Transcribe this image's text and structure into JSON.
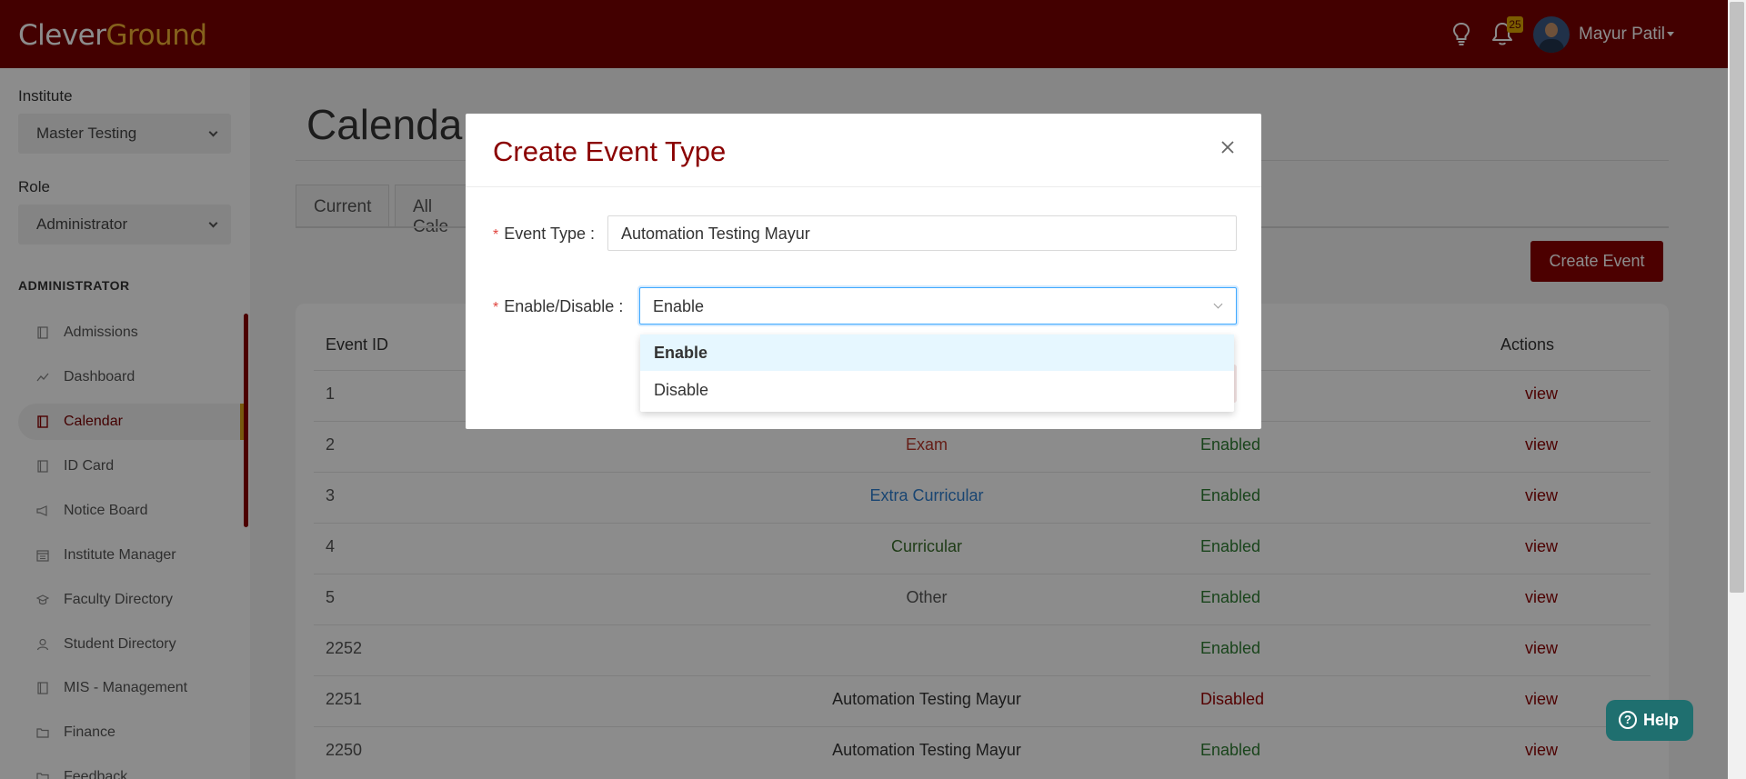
{
  "header": {
    "logo_part1": "Clever",
    "logo_part2": "Ground",
    "notification_count": "25",
    "user_name": "Mayur Patil",
    "colors": {
      "header_bg": "#7a0000",
      "logo_accent": "#f2b233"
    }
  },
  "sidebar": {
    "institute_label": "Institute",
    "institute_value": "Master Testing",
    "role_label": "Role",
    "role_value": "Administrator",
    "section_title": "ADMINISTRATOR",
    "items": [
      {
        "label": "Admissions",
        "icon": "book-icon"
      },
      {
        "label": "Dashboard",
        "icon": "chart-line-icon"
      },
      {
        "label": "Calendar",
        "icon": "book-icon",
        "active": true
      },
      {
        "label": "ID Card",
        "icon": "book-icon"
      },
      {
        "label": "Notice Board",
        "icon": "megaphone-icon"
      },
      {
        "label": "Institute Manager",
        "icon": "calendar-icon"
      },
      {
        "label": "Faculty Directory",
        "icon": "graduation-icon"
      },
      {
        "label": "Student Directory",
        "icon": "user-icon"
      },
      {
        "label": "MIS - Management",
        "icon": "book-icon"
      },
      {
        "label": "Finance",
        "icon": "folder-icon"
      },
      {
        "label": "Feedback",
        "icon": "folder-icon"
      }
    ]
  },
  "main": {
    "title": "Calenda",
    "tabs": [
      "Current",
      "All Cale"
    ],
    "create_event_label": "Create Event",
    "table": {
      "headers": {
        "id": "Event ID",
        "actions": "Actions"
      },
      "rows": [
        {
          "id": "1",
          "name": "",
          "status": "",
          "action": "view"
        },
        {
          "id": "2",
          "name": "Exam",
          "status": "Enabled",
          "action": "view"
        },
        {
          "id": "3",
          "name": "Extra Curricular",
          "status": "Enabled",
          "action": "view"
        },
        {
          "id": "4",
          "name": "Curricular",
          "status": "Enabled",
          "action": "view"
        },
        {
          "id": "5",
          "name": "Other",
          "status": "Enabled",
          "action": "view"
        },
        {
          "id": "2252",
          "name": "",
          "status": "Enabled",
          "action": "view"
        },
        {
          "id": "2251",
          "name": "Automation Testing Mayur",
          "status": "Disabled",
          "action": "view"
        },
        {
          "id": "2250",
          "name": "Automation Testing Mayur",
          "status": "Enabled",
          "action": "view"
        }
      ],
      "name_colors": [
        "#333333",
        "#b8372a",
        "#2f7fcf",
        "#3a6e2a",
        "#555555",
        "#333333",
        "#333333",
        "#333333"
      ],
      "status_colors": {
        "Enabled": "#2e7d32",
        "Disabled": "#9a0000"
      }
    }
  },
  "modal": {
    "title": "Create Event Type",
    "event_type_label": "Event Type",
    "event_type_value": "Automation Testing Mayur",
    "enable_label": "Enable/Disable",
    "enable_value": "Enable",
    "dropdown_options": [
      "Enable",
      "Disable"
    ]
  },
  "help": {
    "label": "Help"
  }
}
